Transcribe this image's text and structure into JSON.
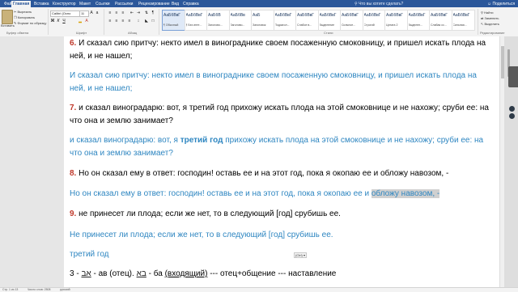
{
  "tabs": [
    "Файл",
    "Главная",
    "Вставка",
    "Конструктор",
    "Макет",
    "Ссылки",
    "Рассылки",
    "Рецензирование",
    "Вид",
    "Справка"
  ],
  "active_tab": "Главная",
  "tell_me": "Что вы хотите сделать?",
  "share": "Поделиться",
  "clipboard": {
    "label": "Буфер обмена",
    "paste": "Вставить",
    "cut": "Вырезать",
    "copy": "Копировать",
    "format_painter": "Формат по образцу"
  },
  "font": {
    "label": "Шрифт",
    "name": "Calibri (Осно",
    "size": "11",
    "bold": "Ж",
    "italic": "К",
    "underline": "Ч"
  },
  "paragraph_label": "Абзац",
  "styles": {
    "label": "Стили",
    "items": [
      {
        "sample": "АаБбВвГ",
        "name": "¶ Обычный"
      },
      {
        "sample": "АаБбВвГ",
        "name": "¶ Без инте..."
      },
      {
        "sample": "АаБбВ",
        "name": "Заголово..."
      },
      {
        "sample": "АаБбВв",
        "name": "Заголово..."
      },
      {
        "sample": "АаБ",
        "name": "Заголовок"
      },
      {
        "sample": "АаБбВвГ",
        "name": "Подзагол..."
      },
      {
        "sample": "АаБбВвГ",
        "name": "Слабое в..."
      },
      {
        "sample": "АаБбВвГ",
        "name": "Выделение"
      },
      {
        "sample": "АаБбВвГ",
        "name": "Сильное..."
      },
      {
        "sample": "АаБбВвГ",
        "name": "Строгий"
      },
      {
        "sample": "АаБбВвГ",
        "name": "Цитата 2"
      },
      {
        "sample": "АаБбВвГ",
        "name": "Выделен..."
      },
      {
        "sample": "АаБбВвГ",
        "name": "Слабая сс..."
      },
      {
        "sample": "АаБбВвГ",
        "name": "Сильная..."
      }
    ]
  },
  "editing": {
    "label": "Редактирование",
    "find": "Найти",
    "replace": "Заменить",
    "select": "Выделить"
  },
  "document": {
    "p6_num": "6.",
    "p6_text": "И сказал сию притчу: некто имел в винограднике своем посаженную смоковницу, и пришел искать плода на ней, и не нашел;",
    "p6_blue": "И сказал сию притчу: некто имел в винограднике своем посаженную смоковницу, и пришел искать плода на ней, и не нашел;",
    "p7_num": "7.",
    "p7_text": "и сказал виноградарю: вот, я третий год прихожу искать плода на этой смоковнице и не нахожу; сруби ее: на что она и землю занимает?",
    "p7_blue_a": "и сказал виноградарю: вот, я ",
    "p7_blue_bold": "третий год",
    "p7_blue_b": " прихожу искать плода на этой смоковнице и не нахожу; сруби ее: на что она и землю занимает?",
    "p8_num": "8.",
    "p8_text": "Но он сказал ему в ответ: господин! оставь ее и на этот год, пока я окопаю ее и обложу навозом, -",
    "p8_blue_a": "Но он сказал ему в ответ: господин! оставь ее и на этот год, пока я окопаю ее и ",
    "p8_blue_hl": "обложу навозом, -",
    "p9_num": "9.",
    "p9_text": "не принесет ли плода; если же нет, то в следующий [год] срубишь ее.",
    "p9_blue": "Не принесет ли плода; если же нет, то в следующий [год] срубишь ее.",
    "third_year": "третий год",
    "paste_badge": "(Ctrl) ▾",
    "line3_num": "3 -",
    "line3_heb1": "אב",
    "line3_a": " - ав (отец).  ",
    "line3_heb2": "בא",
    "line3_b": " - ба ",
    "line3_u": "(входящий)",
    "line3_c": "   --- отец+общение --- наставление"
  },
  "status": {
    "page": "Стр. 1 из 13",
    "words": "Число слов: 2508",
    "lang": "русский"
  }
}
